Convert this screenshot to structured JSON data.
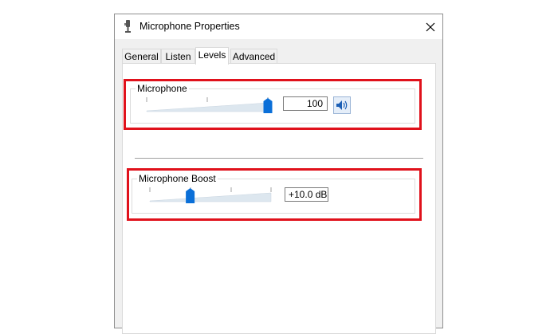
{
  "window": {
    "title": "Microphone Properties",
    "icons": {
      "app": "microphone-icon",
      "close": "close-icon"
    }
  },
  "tabs": [
    {
      "label": "General",
      "active": false
    },
    {
      "label": "Listen",
      "active": false
    },
    {
      "label": "Levels",
      "active": true
    },
    {
      "label": "Advanced",
      "active": false
    }
  ],
  "levels": {
    "microphone": {
      "label": "Microphone",
      "value": "100",
      "level_percent": 100,
      "mute_icon": "speaker-icon"
    },
    "boost": {
      "label": "Microphone Boost",
      "value": "+10.0 dB",
      "level_fraction": 0.333
    }
  },
  "colors": {
    "highlight": "#e0111b",
    "thumb": "#0a6fd8",
    "track_fill": "#dde7ef"
  }
}
